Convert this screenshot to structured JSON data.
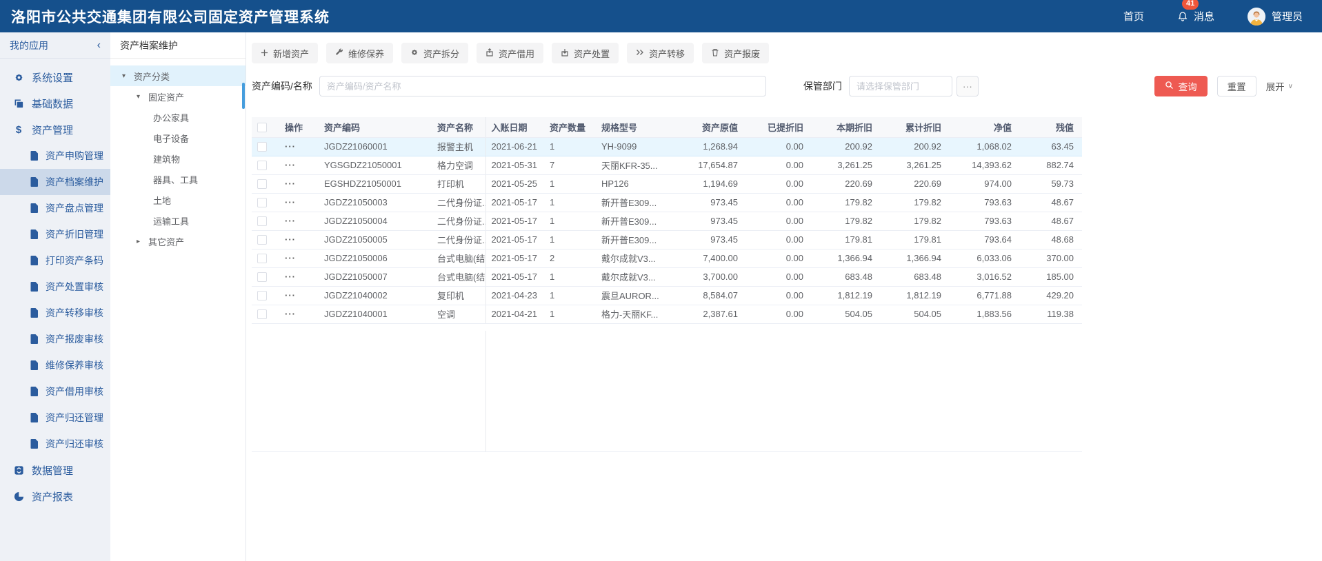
{
  "header": {
    "title": "洛阳市公共交通集团有限公司固定资产管理系统",
    "nav_home": "首页",
    "messages_label": "消息",
    "messages_badge": "41",
    "user_label": "管理员"
  },
  "sidebar": {
    "header": "我的应用",
    "top_items": [
      "系统设置",
      "基础数据",
      "资产管理"
    ],
    "sub_items": [
      "资产申购管理",
      "资产档案维护",
      "资产盘点管理",
      "资产折旧管理",
      "打印资产条码",
      "资产处置审核",
      "资产转移审核",
      "资产报废审核",
      "维修保养审核",
      "资产借用审核",
      "资产归还管理",
      "资产归还审核"
    ],
    "bottom_items": [
      "数据管理",
      "资产报表"
    ]
  },
  "tree_panel": {
    "title": "资产档案维护",
    "category": "资产分类",
    "fixed_assets": "固定资产",
    "leaves": [
      "办公家具",
      "电子设备",
      "建筑物",
      "器具、工具",
      "土地",
      "运输工具"
    ],
    "other_assets": "其它资产"
  },
  "toolbar": {
    "add": "新增资产",
    "maintain": "维修保养",
    "split": "资产拆分",
    "borrow": "资产借用",
    "dispose": "资产处置",
    "transfer": "资产转移",
    "scrap": "资产报废"
  },
  "filters": {
    "asset_label": "资产编码/名称",
    "asset_placeholder": "资产编码/资产名称",
    "dept_label": "保管部门",
    "dept_placeholder": "请选择保管部门",
    "search_label": "查询",
    "reset_label": "重置",
    "expand_label": "展开"
  },
  "table": {
    "columns": [
      "操作",
      "资产编码",
      "资产名称",
      "入账日期",
      "资产数量",
      "规格型号",
      "资产原值",
      "已提折旧",
      "本期折旧",
      "累计折旧",
      "净值",
      "残值"
    ],
    "rows": [
      {
        "selected": true,
        "code": "JGDZ21060001",
        "name": "报警主机",
        "date": "2021-06-21",
        "qty": "1",
        "spec": "YH-9099",
        "original": "1,268.94",
        "accrued": "0.00",
        "current": "200.92",
        "accumulated": "200.92",
        "net": "1,068.02",
        "residual": "63.45"
      },
      {
        "selected": false,
        "code": "YGSGDZ21050001",
        "name": "格力空调",
        "date": "2021-05-31",
        "qty": "7",
        "spec": "天丽KFR-35...",
        "original": "17,654.87",
        "accrued": "0.00",
        "current": "3,261.25",
        "accumulated": "3,261.25",
        "net": "14,393.62",
        "residual": "882.74"
      },
      {
        "selected": false,
        "code": "EGSHDZ21050001",
        "name": "打印机",
        "date": "2021-05-25",
        "qty": "1",
        "spec": "HP126",
        "original": "1,194.69",
        "accrued": "0.00",
        "current": "220.69",
        "accumulated": "220.69",
        "net": "974.00",
        "residual": "59.73"
      },
      {
        "selected": false,
        "code": "JGDZ21050003",
        "name": "二代身份证...",
        "date": "2021-05-17",
        "qty": "1",
        "spec": "新开普E309...",
        "original": "973.45",
        "accrued": "0.00",
        "current": "179.82",
        "accumulated": "179.82",
        "net": "793.63",
        "residual": "48.67"
      },
      {
        "selected": false,
        "code": "JGDZ21050004",
        "name": "二代身份证...",
        "date": "2021-05-17",
        "qty": "1",
        "spec": "新开普E309...",
        "original": "973.45",
        "accrued": "0.00",
        "current": "179.82",
        "accumulated": "179.82",
        "net": "793.63",
        "residual": "48.67"
      },
      {
        "selected": false,
        "code": "JGDZ21050005",
        "name": "二代身份证...",
        "date": "2021-05-17",
        "qty": "1",
        "spec": "新开普E309...",
        "original": "973.45",
        "accrued": "0.00",
        "current": "179.81",
        "accumulated": "179.81",
        "net": "793.64",
        "residual": "48.68"
      },
      {
        "selected": false,
        "code": "JGDZ21050006",
        "name": "台式电脑(结...",
        "date": "2021-05-17",
        "qty": "2",
        "spec": "戴尔成就V3...",
        "original": "7,400.00",
        "accrued": "0.00",
        "current": "1,366.94",
        "accumulated": "1,366.94",
        "net": "6,033.06",
        "residual": "370.00"
      },
      {
        "selected": false,
        "code": "JGDZ21050007",
        "name": "台式电脑(结...",
        "date": "2021-05-17",
        "qty": "1",
        "spec": "戴尔成就V3...",
        "original": "3,700.00",
        "accrued": "0.00",
        "current": "683.48",
        "accumulated": "683.48",
        "net": "3,016.52",
        "residual": "185.00"
      },
      {
        "selected": false,
        "code": "JGDZ21040002",
        "name": "复印机",
        "date": "2021-04-23",
        "qty": "1",
        "spec": "震旦AUROR...",
        "original": "8,584.07",
        "accrued": "0.00",
        "current": "1,812.19",
        "accumulated": "1,812.19",
        "net": "6,771.88",
        "residual": "429.20"
      },
      {
        "selected": false,
        "code": "JGDZ21040001",
        "name": "空调",
        "date": "2021-04-21",
        "qty": "1",
        "spec": "格力-天丽KF...",
        "original": "2,387.61",
        "accrued": "0.00",
        "current": "504.05",
        "accumulated": "504.05",
        "net": "1,883.56",
        "residual": "119.38"
      }
    ]
  },
  "colors": {
    "header_bg": "#15508c",
    "accent_red": "#ee5a52",
    "badge": "#f0563a",
    "selected_row": "#e8f6fe",
    "sidebar_bg": "#eef1f6"
  }
}
